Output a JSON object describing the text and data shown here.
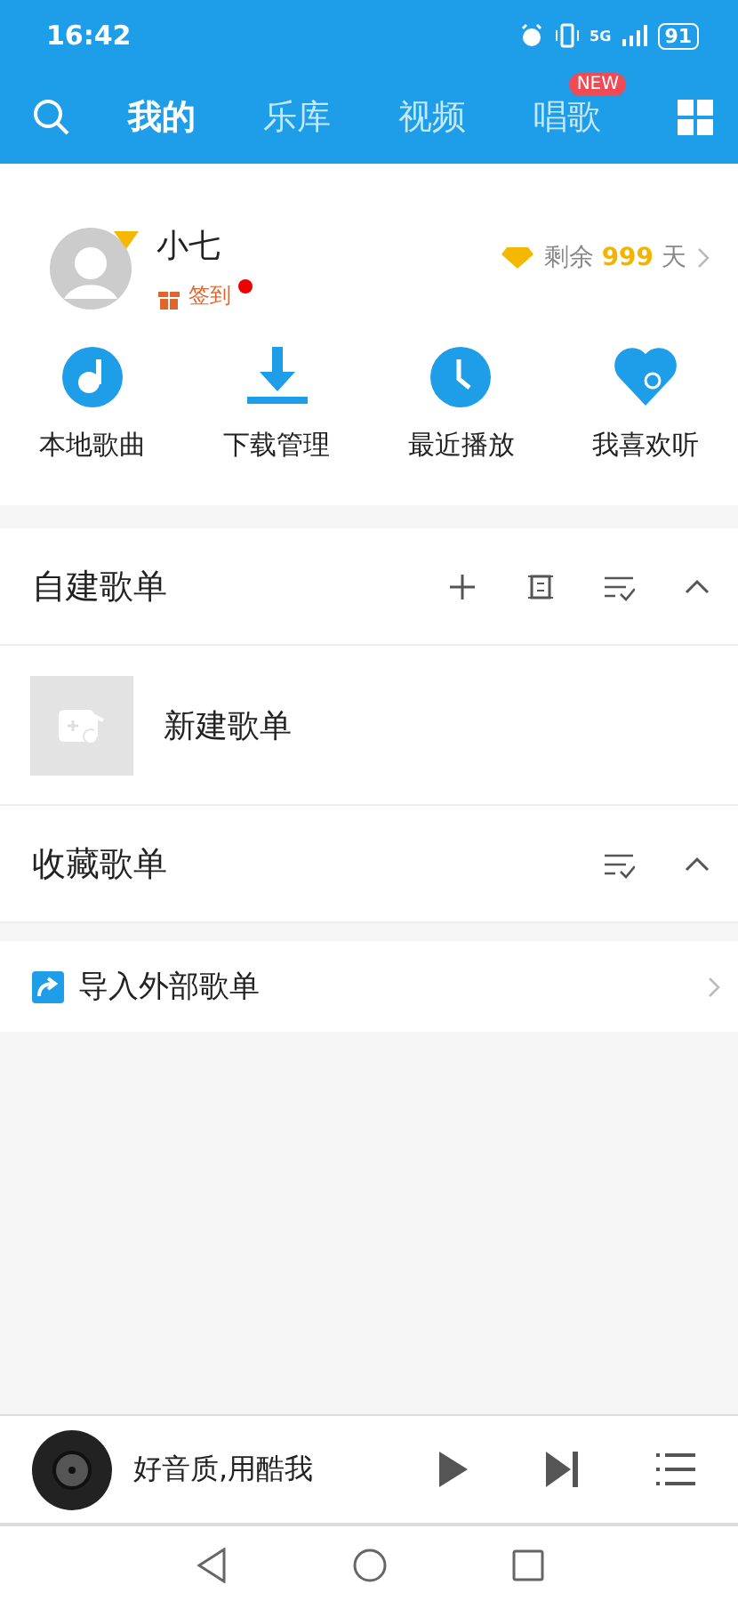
{
  "status_bar": {
    "time": "16:42",
    "network": "5G",
    "battery": "91"
  },
  "tabs": [
    {
      "label": "我的",
      "selected": true
    },
    {
      "label": "乐库",
      "selected": false
    },
    {
      "label": "视频",
      "selected": false
    },
    {
      "label": "唱歌",
      "selected": false,
      "badge": "NEW"
    }
  ],
  "profile": {
    "name": "小七",
    "checkin": "签到",
    "checkin_dot": true,
    "vip_label": "剩余",
    "vip_days": "999",
    "vip_unit": "天"
  },
  "shortcuts": [
    {
      "kind": "music",
      "label": "本地歌曲"
    },
    {
      "kind": "download",
      "label": "下载管理"
    },
    {
      "kind": "clock",
      "label": "最近播放"
    },
    {
      "kind": "heart",
      "label": "我喜欢听"
    }
  ],
  "sections": [
    {
      "title": "自建歌单",
      "expanded": true,
      "actions": [
        {
          "kind": "add"
        },
        {
          "kind": "manage"
        },
        {
          "kind": "sort"
        }
      ],
      "items": [
        {
          "title": "新建歌单"
        }
      ]
    },
    {
      "title": "收藏歌单",
      "expanded": true,
      "actions": [
        {
          "kind": "sort"
        }
      ]
    }
  ],
  "import": {
    "label": "导入外部歌单"
  },
  "player": {
    "title": "好音质,用酷我",
    "playing": false
  }
}
